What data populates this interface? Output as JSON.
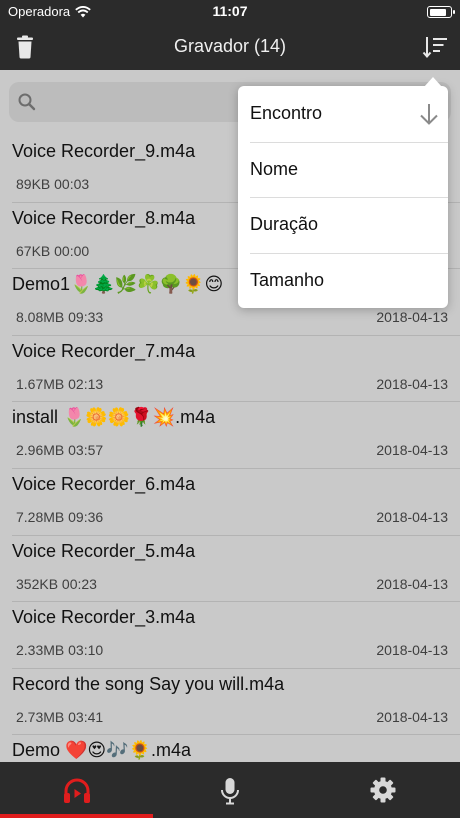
{
  "status_bar": {
    "carrier": "Operadora",
    "time": "11:07",
    "battery_level": 0.85
  },
  "nav": {
    "title": "Gravador (14)",
    "trash_icon": "trash-icon",
    "sort_icon": "sort-icon"
  },
  "search": {
    "placeholder": "",
    "value": ""
  },
  "recordings": [
    {
      "name": "Voice Recorder_9.m4a",
      "meta": "89KB 00:03",
      "date": ""
    },
    {
      "name": "Voice Recorder_8.m4a",
      "meta": "67KB 00:00",
      "date": ""
    },
    {
      "name": "Demo1🌷🌲🌿☘️🌳🌻😊",
      "meta": "8.08MB 09:33",
      "date": "2018-04-13"
    },
    {
      "name": "Voice Recorder_7.m4a",
      "meta": "1.67MB 02:13",
      "date": "2018-04-13"
    },
    {
      "name": "install 🌷🌼🌼🌹💥.m4a",
      "meta": "2.96MB 03:57",
      "date": "2018-04-13"
    },
    {
      "name": "Voice Recorder_6.m4a",
      "meta": "7.28MB 09:36",
      "date": "2018-04-13"
    },
    {
      "name": "Voice Recorder_5.m4a",
      "meta": "352KB 00:23",
      "date": "2018-04-13"
    },
    {
      "name": "Voice Recorder_3.m4a",
      "meta": "2.33MB 03:10",
      "date": "2018-04-13"
    },
    {
      "name": "Record the song Say you will.m4a",
      "meta": "2.73MB 03:41",
      "date": "2018-04-13"
    },
    {
      "name": "Demo ❤️😍🎶🌻.m4a",
      "meta": "",
      "date": ""
    }
  ],
  "sort_menu": {
    "options": [
      "Encontro",
      "Nome",
      "Duração",
      "Tamanho"
    ],
    "selected_direction_icon": "arrow-down-icon"
  },
  "tabs": [
    {
      "icon": "headphones-play-icon",
      "active": true
    },
    {
      "icon": "microphone-icon",
      "active": false
    },
    {
      "icon": "gear-icon",
      "active": false
    }
  ],
  "colors": {
    "accent": "#e01d1d",
    "bar": "#2b2b2b",
    "list_bg": "#c9c9c9"
  }
}
